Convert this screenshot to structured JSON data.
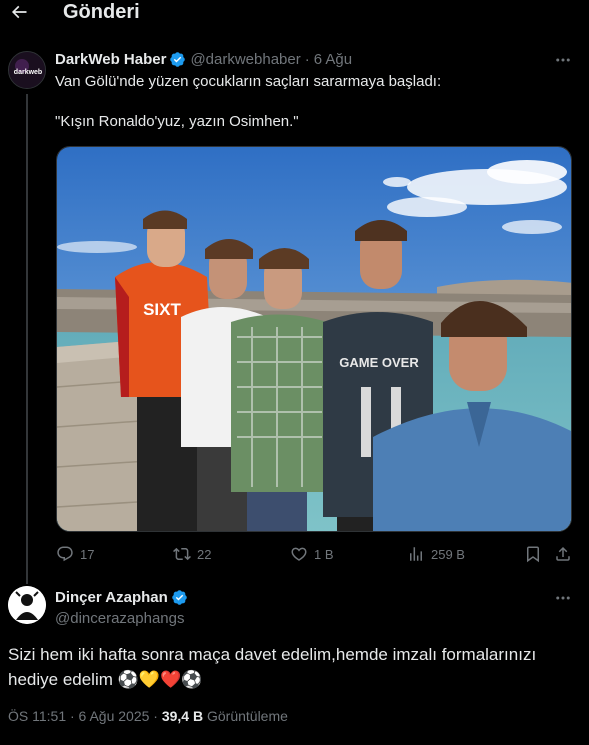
{
  "header": {
    "title": "Gönderi"
  },
  "tweet": {
    "author_name": "DarkWeb Haber",
    "author_handle": "@darkwebhaber",
    "separator": "·",
    "date": "6 Ağu",
    "avatar_text": "darkweb",
    "text_line1": "Van Gölü'nde yüzen çocukların saçları sararmaya başladı:",
    "text_line2": "\"Kışın Ronaldo'yuz, yazın Osimhen.\"",
    "image_description_colors": {
      "sky": "#3f7fd0",
      "water": "#6fb7c4",
      "dock": "#b9b3a8"
    },
    "jersey_text": "SIXT",
    "shirt_text": "GAME OVER",
    "actions": {
      "replies": "17",
      "reposts": "22",
      "likes": "1 B",
      "views": "259 B"
    }
  },
  "reply": {
    "author_name": "Dinçer Azaphan",
    "author_handle": "@dincerazaphangs",
    "text": "Sizi hem iki hafta sonra maça davet edelim,hemde imzalı formalarınızı hediye edelim ⚽💛❤️⚽",
    "time": "ÖS 11:51 · 6 Ağu 2025 ·",
    "views_count": "39,4 B",
    "views_label": "Görüntüleme"
  },
  "colors": {
    "background": "#000000",
    "text_primary": "#e7e9ea",
    "text_secondary": "#71767b",
    "verified": "#1d9bf0",
    "divider": "#2f3336"
  }
}
